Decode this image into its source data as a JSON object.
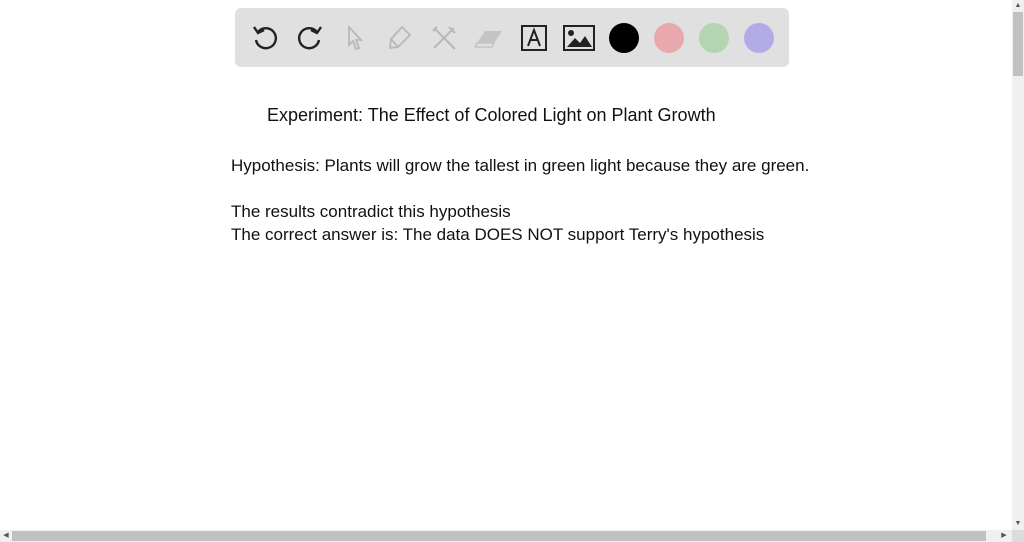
{
  "toolbar": {
    "tools": [
      "undo-icon",
      "redo-icon",
      "select-pointer-icon",
      "pencil-icon",
      "tools-icon",
      "eraser-icon",
      "text-icon",
      "image-icon"
    ],
    "colors": {
      "black": "#000000",
      "pink": "#e8a8ae",
      "green": "#b3d6b1",
      "purple": "#b3abe6"
    }
  },
  "content": {
    "title": "Experiment:  The Effect of Colored Light on Plant Growth",
    "hypothesis": "Hypothesis:  Plants will grow the tallest in green light because they are green.",
    "result": "The results contradict this hypothesis",
    "answer": "The correct answer is:  The data DOES NOT support Terry's hypothesis"
  }
}
